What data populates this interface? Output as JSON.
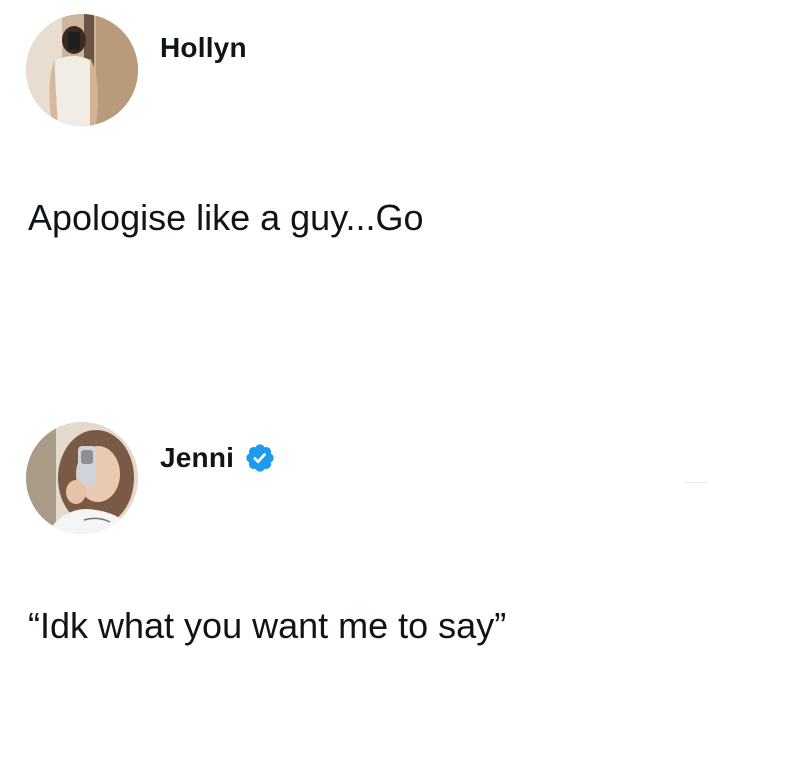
{
  "posts": [
    {
      "author": "Hollyn",
      "verified": false,
      "avatar": "user-avatar-mirror-selfie",
      "text": "Apologise like a guy...Go"
    },
    {
      "author": "Jenni",
      "verified": true,
      "avatar": "user-avatar-phone-selfie",
      "text": "“Idk what you want me to say”"
    }
  ],
  "colors": {
    "text": "#0f1419",
    "background": "#ffffff",
    "verified_badge": "#1d9bf0"
  }
}
